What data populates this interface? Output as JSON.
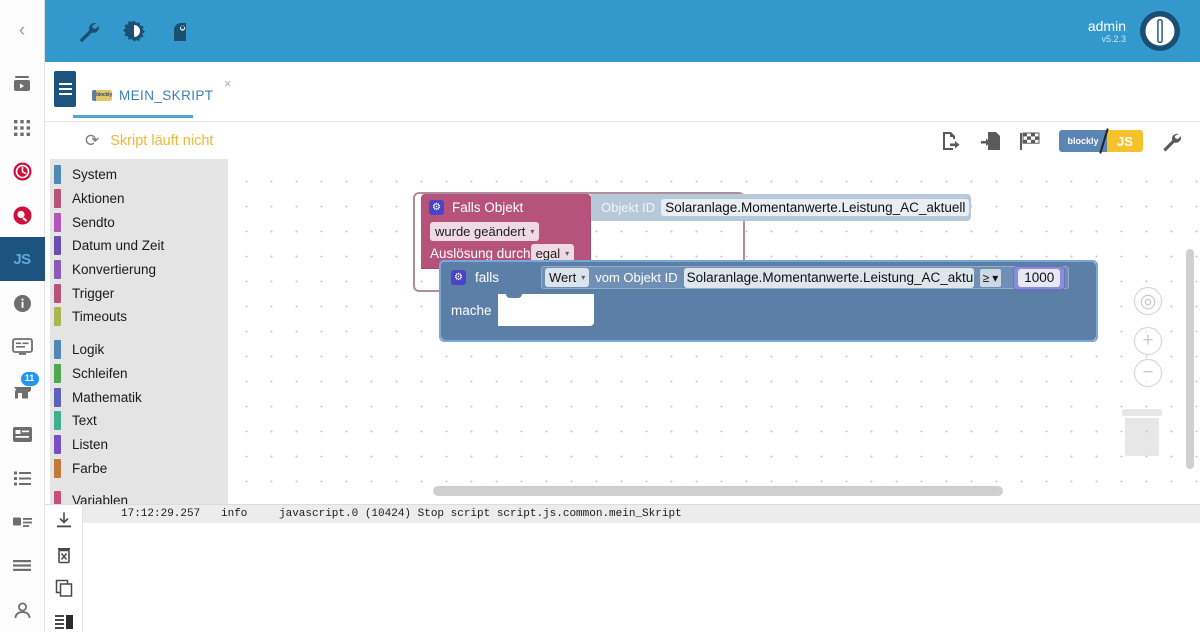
{
  "topbar": {
    "icons": [
      {
        "name": "wrench-icon",
        "glyph": "⚒"
      },
      {
        "name": "contrast-icon",
        "glyph": "◐"
      },
      {
        "name": "expert-mode-icon",
        "glyph": "♟"
      }
    ],
    "user": "admin",
    "version": "v5.2.3",
    "logo_name": "iobroker-logo"
  },
  "rail": {
    "collapse_glyph": "‹",
    "items": [
      {
        "name": "sidebar-item-scenes",
        "glyph": "▶"
      },
      {
        "name": "sidebar-item-adapters",
        "glyph": "∷"
      },
      {
        "name": "sidebar-item-history",
        "glyph": "◴"
      },
      {
        "name": "sidebar-item-search",
        "glyph": "●"
      },
      {
        "name": "sidebar-item-scripts",
        "label": "JS"
      },
      {
        "name": "sidebar-item-info",
        "glyph": "i"
      },
      {
        "name": "sidebar-item-logs",
        "glyph": "▤"
      },
      {
        "name": "sidebar-item-store",
        "glyph": "⌂",
        "badge": "11"
      },
      {
        "name": "sidebar-item-instances",
        "glyph": "▥"
      },
      {
        "name": "sidebar-item-objects",
        "glyph": "≣"
      },
      {
        "name": "sidebar-item-enums",
        "glyph": "▦"
      },
      {
        "name": "sidebar-item-files",
        "glyph": "☰"
      },
      {
        "name": "sidebar-item-users",
        "glyph": "⚹"
      }
    ]
  },
  "tab": {
    "script_name": "MEIN_SKRIPT",
    "badge_text": "blockly",
    "close_glyph": "×"
  },
  "status": {
    "reload_glyph": "⟳",
    "text": "Skript läuft nicht",
    "tools": [
      {
        "name": "export-script-icon",
        "glyph": "⮊"
      },
      {
        "name": "import-script-icon",
        "glyph": "⮋"
      },
      {
        "name": "checkered-flag-icon",
        "glyph": "⚑"
      }
    ],
    "toggle_left": "blockly",
    "toggle_right": "JS",
    "settings_glyph": "⚒"
  },
  "toolbox": {
    "groups": [
      [
        {
          "label": "System",
          "color": "#4f88b0"
        },
        {
          "label": "Aktionen",
          "color": "#b5537c"
        },
        {
          "label": "Sendto",
          "color": "#b057b8"
        },
        {
          "label": "Datum und Zeit",
          "color": "#6a4fb0"
        },
        {
          "label": "Konvertierung",
          "color": "#8a5ab8"
        },
        {
          "label": "Trigger",
          "color": "#b5537c"
        },
        {
          "label": "Timeouts",
          "color": "#a8b84f"
        }
      ],
      [
        {
          "label": "Logik",
          "color": "#4f88b8"
        },
        {
          "label": "Schleifen",
          "color": "#4fa84f"
        },
        {
          "label": "Mathematik",
          "color": "#5a63b8"
        },
        {
          "label": "Text",
          "color": "#3fb08c"
        },
        {
          "label": "Listen",
          "color": "#7a4fc4"
        },
        {
          "label": "Farbe",
          "color": "#c07a3a"
        }
      ],
      [
        {
          "label": "Variablen",
          "color": "#c44f7a"
        }
      ]
    ]
  },
  "blocks": {
    "trigger": {
      "gear_glyph": "⚙",
      "title": "Falls Objekt",
      "change_field": "wurde geändert",
      "trigger_by_label": "Auslösung durch",
      "trigger_by_value": "egal",
      "objid_label": "Objekt ID",
      "objid_value": "Solaranlage.Momentanwerte.Leistung_AC_aktuell",
      "caret": "▾"
    },
    "condition": {
      "gear_glyph": "⚙",
      "if_label": "falls",
      "value_field": "Wert",
      "from_label": "vom Objekt ID",
      "objid_value": "Solaranlage.Momentanwerte.Leistung_AC_aktu",
      "operator": "≥",
      "number": "1000",
      "do_label": "mache",
      "caret": "▾"
    }
  },
  "workspace": {
    "center_glyph": "◎",
    "zoom_in_glyph": "+",
    "zoom_out_glyph": "−",
    "trash_name": "trash-can-icon"
  },
  "log": {
    "tools": [
      {
        "name": "download-log-icon",
        "glyph": "⤓"
      },
      {
        "name": "clear-log-icon",
        "glyph": "⌧"
      },
      {
        "name": "copy-log-icon",
        "glyph": "❐"
      },
      {
        "name": "log-layout-icon",
        "glyph": "▤"
      }
    ],
    "lines": [
      {
        "timestamp": "17:12:29.257",
        "level": "info",
        "message": "javascript.0 (10424) Stop script script.js.common.mein_Skript"
      }
    ]
  }
}
